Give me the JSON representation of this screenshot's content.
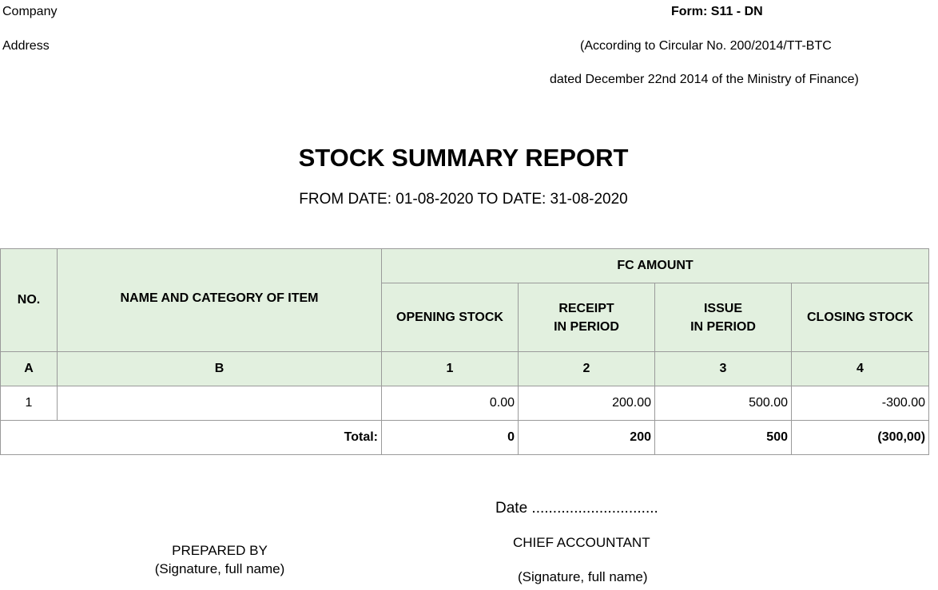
{
  "header": {
    "company_label": "Company",
    "address_label": "Address",
    "form_code": "Form: S11 - DN",
    "circular": "(According to Circular No. 200/2014/TT-BTC",
    "dated": "dated December 22nd 2014 of the Ministry of Finance)"
  },
  "report": {
    "title": "STOCK SUMMARY REPORT",
    "period": "FROM DATE: 01-08-2020 TO DATE: 31-08-2020"
  },
  "table": {
    "headers": {
      "no": "NO.",
      "name": "NAME AND CATEGORY OF ITEM",
      "fc_amount": "FC AMOUNT",
      "opening_stock": "OPENING STOCK",
      "receipt_line1": "RECEIPT",
      "receipt_line2": "IN PERIOD",
      "issue_line1": "ISSUE",
      "issue_line2": "IN PERIOD",
      "closing_stock": "CLOSING STOCK"
    },
    "codes": [
      "A",
      "B",
      "1",
      "2",
      "3",
      "4"
    ],
    "rows": [
      {
        "no": "1",
        "name": "",
        "opening": "0.00",
        "receipt": "200.00",
        "issue": "500.00",
        "closing": "-300.00"
      }
    ],
    "total": {
      "label": "Total:",
      "opening": "0",
      "receipt": "200",
      "issue": "500",
      "closing": "(300,00)"
    }
  },
  "footer": {
    "date_line": "Date ..............................",
    "prepared_by": "PREPARED BY",
    "prepared_sig": "(Signature, full name)",
    "chief_accountant": "CHIEF ACCOUNTANT",
    "chief_sig": "(Signature, full name)"
  },
  "colors": {
    "header_fill": "#e2f0df",
    "border": "#9a9a9a"
  }
}
